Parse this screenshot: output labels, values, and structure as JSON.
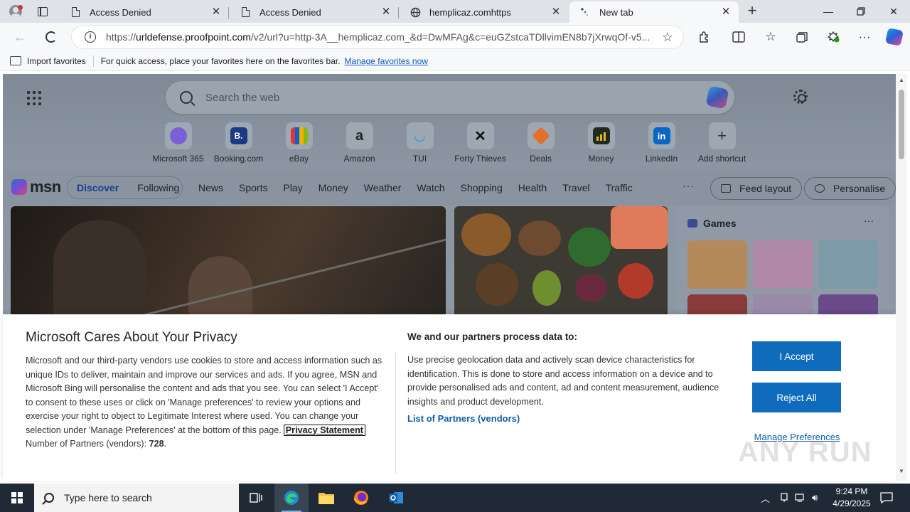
{
  "tabs": [
    {
      "label": "Access Denied",
      "icon": "document-icon"
    },
    {
      "label": "Access Denied",
      "icon": "document-icon"
    },
    {
      "label": "hemplicaz.comhttps",
      "icon": "globe-icon"
    },
    {
      "label": "New tab",
      "icon": "loading-icon"
    }
  ],
  "address": {
    "url_prefix": "https://",
    "url_host": "urldefense.proofpoint.com",
    "url_rest": "/v2/url?u=http-3A__hemplicaz.com_&d=DwMFAg&c=euGZstcaTDllvimEN8b7jXrwqOf-v5..."
  },
  "favorites_bar": {
    "import_label": "Import favorites",
    "message": "For quick access, place your favorites here on the favorites bar.",
    "manage_link": "Manage favorites now"
  },
  "newtab": {
    "search_placeholder": "Search the web",
    "shortcuts": [
      {
        "label": "Microsoft 365",
        "color": "#7b5fd6"
      },
      {
        "label": "Booking.com",
        "color": "#1b3a82"
      },
      {
        "label": "eBay",
        "color": "#e53238"
      },
      {
        "label": "Amazon",
        "color": "#222222"
      },
      {
        "label": "TUI",
        "color": "#3aa0e6"
      },
      {
        "label": "Forty Thieves",
        "color": "#111111"
      },
      {
        "label": "Deals",
        "color": "#e2702a"
      },
      {
        "label": "Money",
        "color": "#1f2a1f"
      },
      {
        "label": "LinkedIn",
        "color": "#0a66c2"
      },
      {
        "label": "Add shortcut",
        "color": "#9ea8b2"
      }
    ]
  },
  "msn": {
    "logo": "msn",
    "discover": "Discover",
    "following": "Following",
    "nav": [
      "News",
      "Sports",
      "Play",
      "Money",
      "Weather",
      "Watch",
      "Shopping",
      "Health",
      "Travel",
      "Traffic"
    ],
    "more": "···",
    "feed_layout": "Feed layout",
    "personalise": "Personalise",
    "games_title": "Games",
    "games_more": "···"
  },
  "consent": {
    "title": "Microsoft Cares About Your Privacy",
    "body": "Microsoft and our third-party vendors use cookies to store and access information such as unique IDs to deliver, maintain and improve our services and ads. If you agree, MSN and Microsoft Bing will personalise the content and ads that you see. You can select 'I Accept' to consent to these uses or click on 'Manage preferences' to review your options and exercise your right to object to Legitimate Interest where used.  You can change your selection under 'Manage Preferences' at the bottom of this page.",
    "privacy_link": "Privacy Statement",
    "partners_label": "Number of Partners (vendors):",
    "partners_count": "728",
    "partners_suffix": ".",
    "process_title": "We and our partners process data to:",
    "process_body": "Use precise geolocation data and actively scan device characteristics for identification. This is done to store and access information on a device and to provide personalised ads and content, ad and content measurement, audience insights and product development.",
    "partners_link": "List of Partners (vendors)",
    "accept": "I Accept",
    "reject": "Reject All",
    "manage": "Manage Preferences"
  },
  "watermark": "ANY RUN",
  "taskbar": {
    "search_placeholder": "Type here to search",
    "time": "9:24 PM",
    "date": "4/29/2025"
  },
  "colors": {
    "accent": "#0f6cbd",
    "link": "#0f5ea8",
    "taskbar": "#1f2a36"
  }
}
